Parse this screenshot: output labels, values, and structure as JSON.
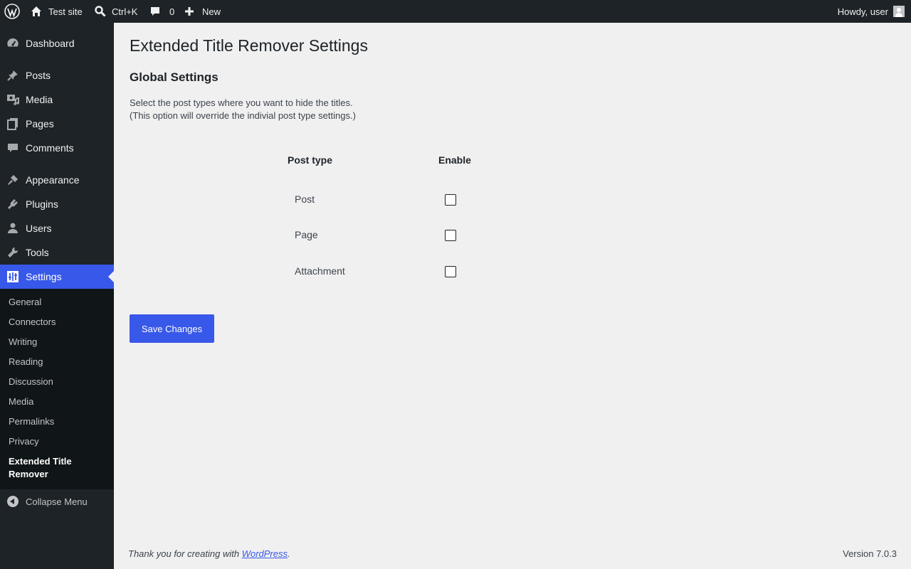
{
  "admin_bar": {
    "site_name": "Test site",
    "search_shortcut": "Ctrl+K",
    "comments_count": "0",
    "new_label": "New",
    "greeting": "Howdy, user"
  },
  "sidebar": {
    "items": [
      {
        "label": "Dashboard",
        "icon": "dashboard-icon"
      },
      {
        "label": "Posts",
        "icon": "pin-icon"
      },
      {
        "label": "Media",
        "icon": "media-icon"
      },
      {
        "label": "Pages",
        "icon": "pages-icon"
      },
      {
        "label": "Comments",
        "icon": "comment-icon"
      },
      {
        "label": "Appearance",
        "icon": "brush-icon"
      },
      {
        "label": "Plugins",
        "icon": "plugin-icon"
      },
      {
        "label": "Users",
        "icon": "user-icon"
      },
      {
        "label": "Tools",
        "icon": "wrench-icon"
      },
      {
        "label": "Settings",
        "icon": "settings-icon"
      }
    ],
    "submenu": [
      "General",
      "Connectors",
      "Writing",
      "Reading",
      "Discussion",
      "Media",
      "Permalinks",
      "Privacy",
      "Extended Title Remover"
    ],
    "collapse_label": "Collapse Menu"
  },
  "main": {
    "title": "Extended Title Remover Settings",
    "section_title": "Global Settings",
    "description_line1": "Select the post types where you want to hide the titles.",
    "description_line2": "(This option will override the indivial post type settings.)",
    "table": {
      "col_post_type": "Post type",
      "col_enable": "Enable",
      "rows": [
        {
          "label": "Post",
          "checked": false
        },
        {
          "label": "Page",
          "checked": false
        },
        {
          "label": "Attachment",
          "checked": false
        }
      ]
    },
    "save_label": "Save Changes"
  },
  "footer": {
    "thanks_prefix": "Thank you for creating with ",
    "thanks_link": "WordPress",
    "thanks_suffix": ".",
    "version": "Version 7.0.3"
  },
  "colors": {
    "accent": "#3858e9",
    "sidebar_bg": "#1d2327",
    "submenu_bg": "#101517",
    "content_bg": "#f0f0f1"
  }
}
